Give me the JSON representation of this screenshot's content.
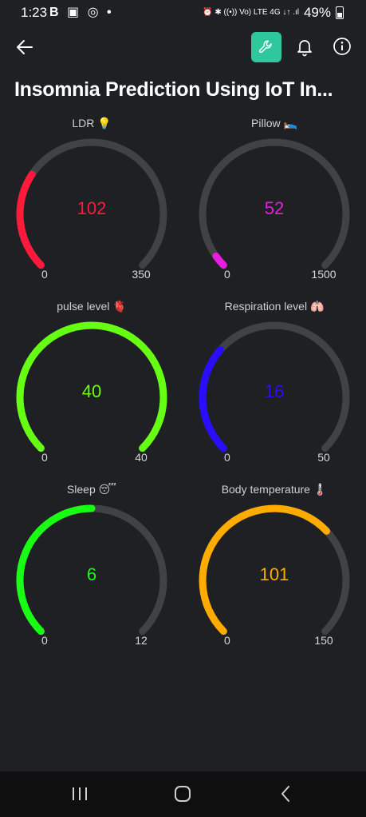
{
  "status_bar": {
    "time": "1:23",
    "left_icons": "B ▣ ◎ •",
    "right_icons": "⏰ ✱ ((•)) Vo) LTE 4G ↓↑ .ıl",
    "battery": "49%"
  },
  "header": {
    "title": "Insomnia Prediction Using IoT In..."
  },
  "gauges": [
    {
      "label": "LDR 💡",
      "value": "102",
      "min": "0",
      "max": "350",
      "value_num": 102,
      "min_num": 0,
      "max_num": 350,
      "color": "#ff1a3c"
    },
    {
      "label": "Pillow 🛌",
      "value": "52",
      "min": "0",
      "max": "1500",
      "value_num": 52,
      "min_num": 0,
      "max_num": 1500,
      "color": "#e81de0"
    },
    {
      "label": "pulse level 🫀",
      "value": "40",
      "min": "0",
      "max": "40",
      "value_num": 40,
      "min_num": 0,
      "max_num": 40,
      "color": "#66ff14"
    },
    {
      "label": "Respiration level 🫁",
      "value": "16",
      "min": "0",
      "max": "50",
      "value_num": 16,
      "min_num": 0,
      "max_num": 50,
      "color": "#2a0cff"
    },
    {
      "label": "Sleep 😴",
      "value": "6",
      "min": "0",
      "max": "12",
      "value_num": 6,
      "min_num": 0,
      "max_num": 12,
      "color": "#19ff14"
    },
    {
      "label": "Body temperature 🌡️",
      "value": "101",
      "min": "0",
      "max": "150",
      "value_num": 101,
      "min_num": 0,
      "max_num": 150,
      "color": "#ffab00"
    }
  ],
  "colors": {
    "background": "#1f2023",
    "track": "#414246",
    "accent": "#2fc79c"
  },
  "icons": {
    "back": "arrow-left-icon",
    "settings": "wrench-icon",
    "notifications": "bell-icon",
    "info": "info-icon"
  }
}
